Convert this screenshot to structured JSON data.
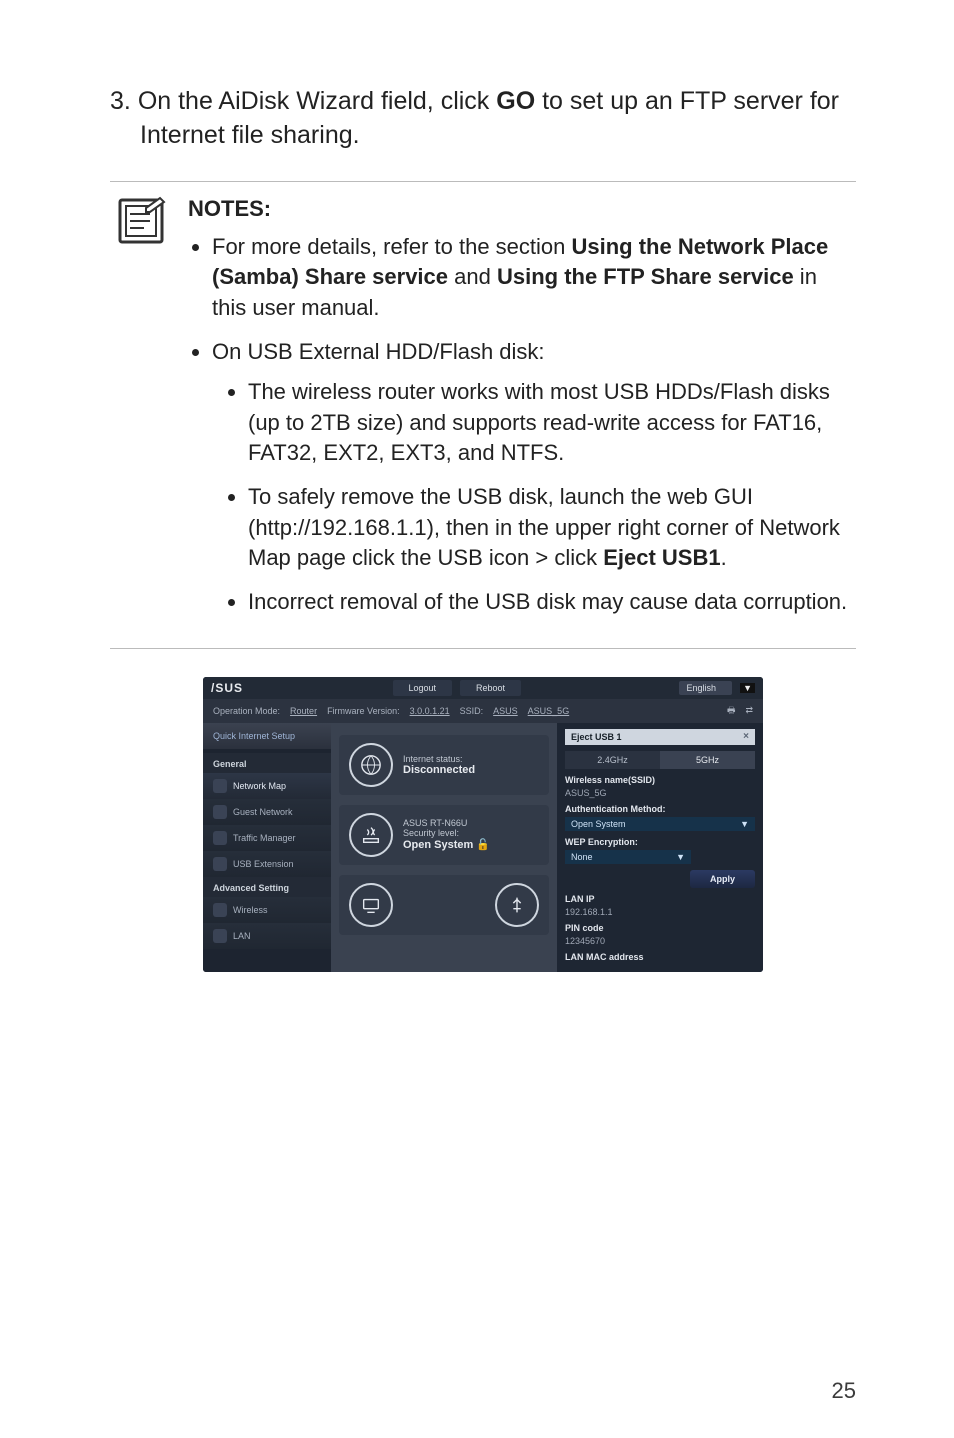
{
  "step": {
    "num": "3.",
    "prefix": "On the AiDisk Wizard field, click ",
    "bold": "GO",
    "suffix": " to set up an FTP server for Internet file sharing."
  },
  "notes": {
    "title": "NOTES",
    "bullets": {
      "b1_prefix": "For more details, refer to the section ",
      "b1_bold1": "Using the Network Place (Samba) Share service",
      "b1_mid": " and ",
      "b1_bold2": "Using the FTP Share service",
      "b1_suffix": " in this user manual.",
      "b2": "On USB External HDD/Flash disk:",
      "b2a": "The wireless router works with most USB HDDs/Flash disks (up to 2TB size) and supports read-write access for FAT16, FAT32, EXT2, EXT3, and NTFS.",
      "b2b_prefix": "To safely remove the USB disk, launch the web GUI (http://192.168.1.1), then in the upper right corner of Network Map page click the USB icon > click ",
      "b2b_bold": "Eject USB1",
      "b2b_suffix": ".",
      "b2c": "Incorrect removal of the USB disk may cause data corruption."
    }
  },
  "router": {
    "logo": "/SUS",
    "logout": "Logout",
    "reboot": "Reboot",
    "language": "English",
    "opmode_label": "Operation Mode:",
    "opmode_value": "Router",
    "fw_label": "Firmware Version:",
    "fw_value": "3.0.0.1.21",
    "ssid_label": "SSID:",
    "ssid_value": "ASUS",
    "ssid2_value": "ASUS_5G",
    "qis": "Quick Internet Setup",
    "section_general": "General",
    "menu_map": "Network Map",
    "menu_guest": "Guest Network",
    "menu_traffic": "Traffic Manager",
    "menu_usb": "USB Extension",
    "section_adv": "Advanced Setting",
    "menu_wireless": "Wireless",
    "menu_lan": "LAN",
    "center": {
      "internet_status_lbl": "Internet status:",
      "internet_status_val": "Disconnected",
      "router_model": "ASUS RT-N66U",
      "sec_level_lbl": "Security level:",
      "sec_level_val": "Open System"
    },
    "right": {
      "eject": "Eject USB 1",
      "tab24": "2.4GHz",
      "tab5": "5GHz",
      "wname_lbl": "Wireless name(SSID)",
      "wname_val": "ASUS_5G",
      "auth_lbl": "Authentication Method:",
      "auth_val": "Open System",
      "wep_lbl": "WEP Encryption:",
      "wep_val": "None",
      "apply": "Apply",
      "lanip_lbl": "LAN IP",
      "lanip_val": "192.168.1.1",
      "pin_lbl": "PIN code",
      "pin_val": "12345670",
      "mac_lbl": "LAN MAC address"
    }
  },
  "page_number": "25"
}
